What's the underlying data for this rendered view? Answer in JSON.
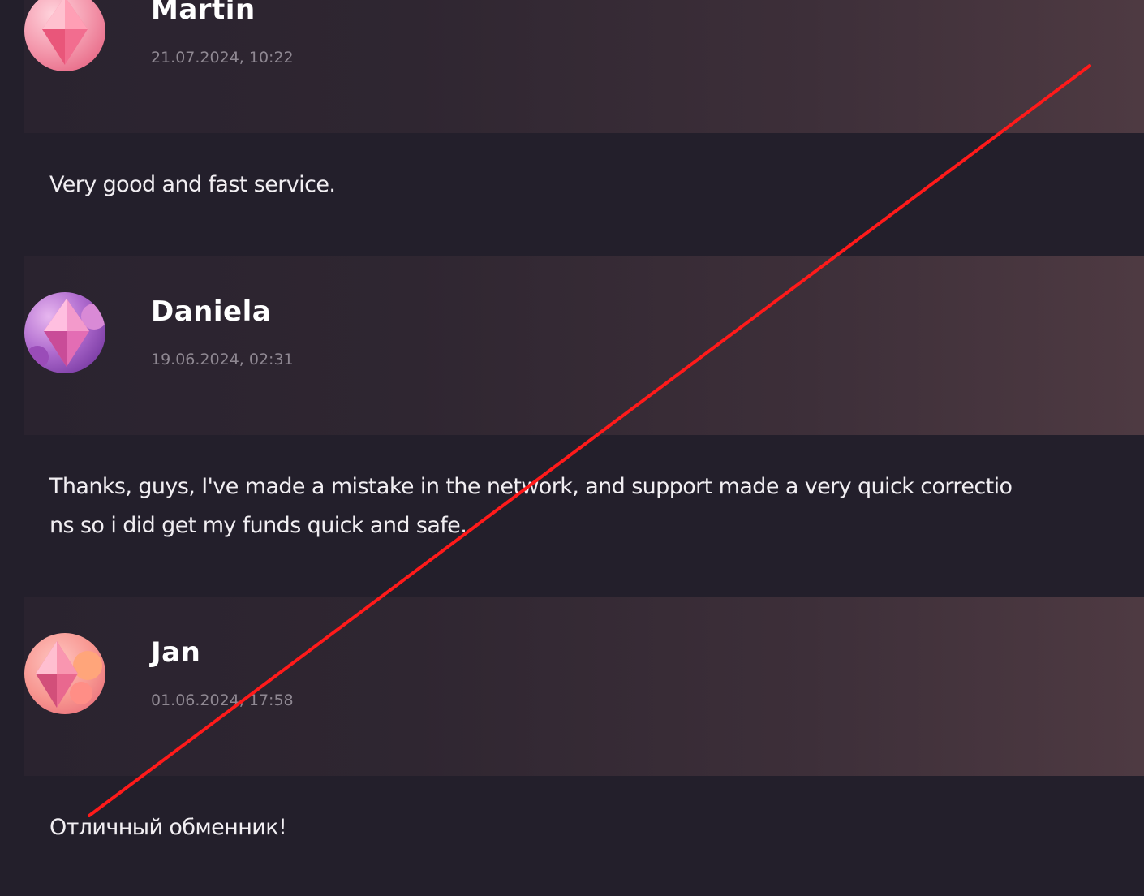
{
  "reviews": [
    {
      "author": "Martin",
      "date": "21.07.2024, 10:22",
      "text_lines": [
        "Very good and fast service."
      ],
      "avatar_icon": "pink-crystal-avatar-icon"
    },
    {
      "author": "Daniela",
      "date": "19.06.2024, 02:31",
      "text_lines": [
        "Thanks, guys, I've made a mistake in the network, and support made a very quick correctio",
        "ns so i did get my funds quick and safe."
      ],
      "avatar_icon": "purple-crystal-avatar-icon"
    },
    {
      "author": "Jan",
      "date": "01.06.2024, 17:58",
      "text_lines": [
        "Отличный обменник!"
      ],
      "avatar_icon": "coral-crystal-avatar-icon"
    }
  ],
  "colors": {
    "background": "#231f2b",
    "header_gradient_end": "#4e3a42",
    "author_text": "#ffffff",
    "date_text": "#8f8892",
    "body_text": "#f1eef2",
    "strike_line": "#ff1a1a"
  }
}
